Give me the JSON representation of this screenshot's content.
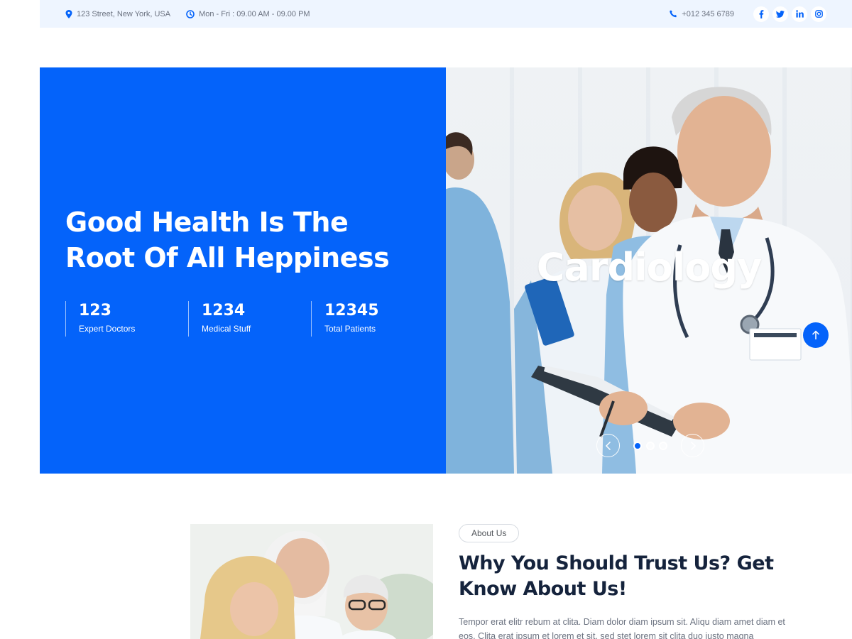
{
  "topbar": {
    "address": "123 Street, New York, USA",
    "hours": "Mon - Fri : 09.00 AM - 09.00 PM",
    "phone": "+012 345 6789",
    "socials": [
      {
        "icon": "facebook-icon",
        "glyph": "f"
      },
      {
        "icon": "twitter-icon",
        "glyph": "t"
      },
      {
        "icon": "linkedin-icon",
        "glyph": "in"
      },
      {
        "icon": "instagram-icon",
        "glyph": "ig"
      }
    ]
  },
  "hero": {
    "title": "Good Health Is The Root Of All Heppiness",
    "stats": [
      {
        "number": "123",
        "label": "Expert Doctors"
      },
      {
        "number": "1234",
        "label": "Medical Stuff"
      },
      {
        "number": "12345",
        "label": "Total Patients"
      }
    ],
    "caption": "Cardiology",
    "carousel": {
      "active_index": 0,
      "count": 3
    }
  },
  "about": {
    "badge": "About Us",
    "title": "Why You Should Trust Us? Get Know About Us!",
    "text": "Tempor erat elitr rebum at clita. Diam dolor diam ipsum sit. Aliqu diam amet diam et eos. Clita erat ipsum et lorem et sit, sed stet lorem sit clita duo justo magna"
  },
  "colors": {
    "primary": "#0463fa",
    "topbar_bg": "#eef5ff",
    "heading": "#15233c"
  }
}
